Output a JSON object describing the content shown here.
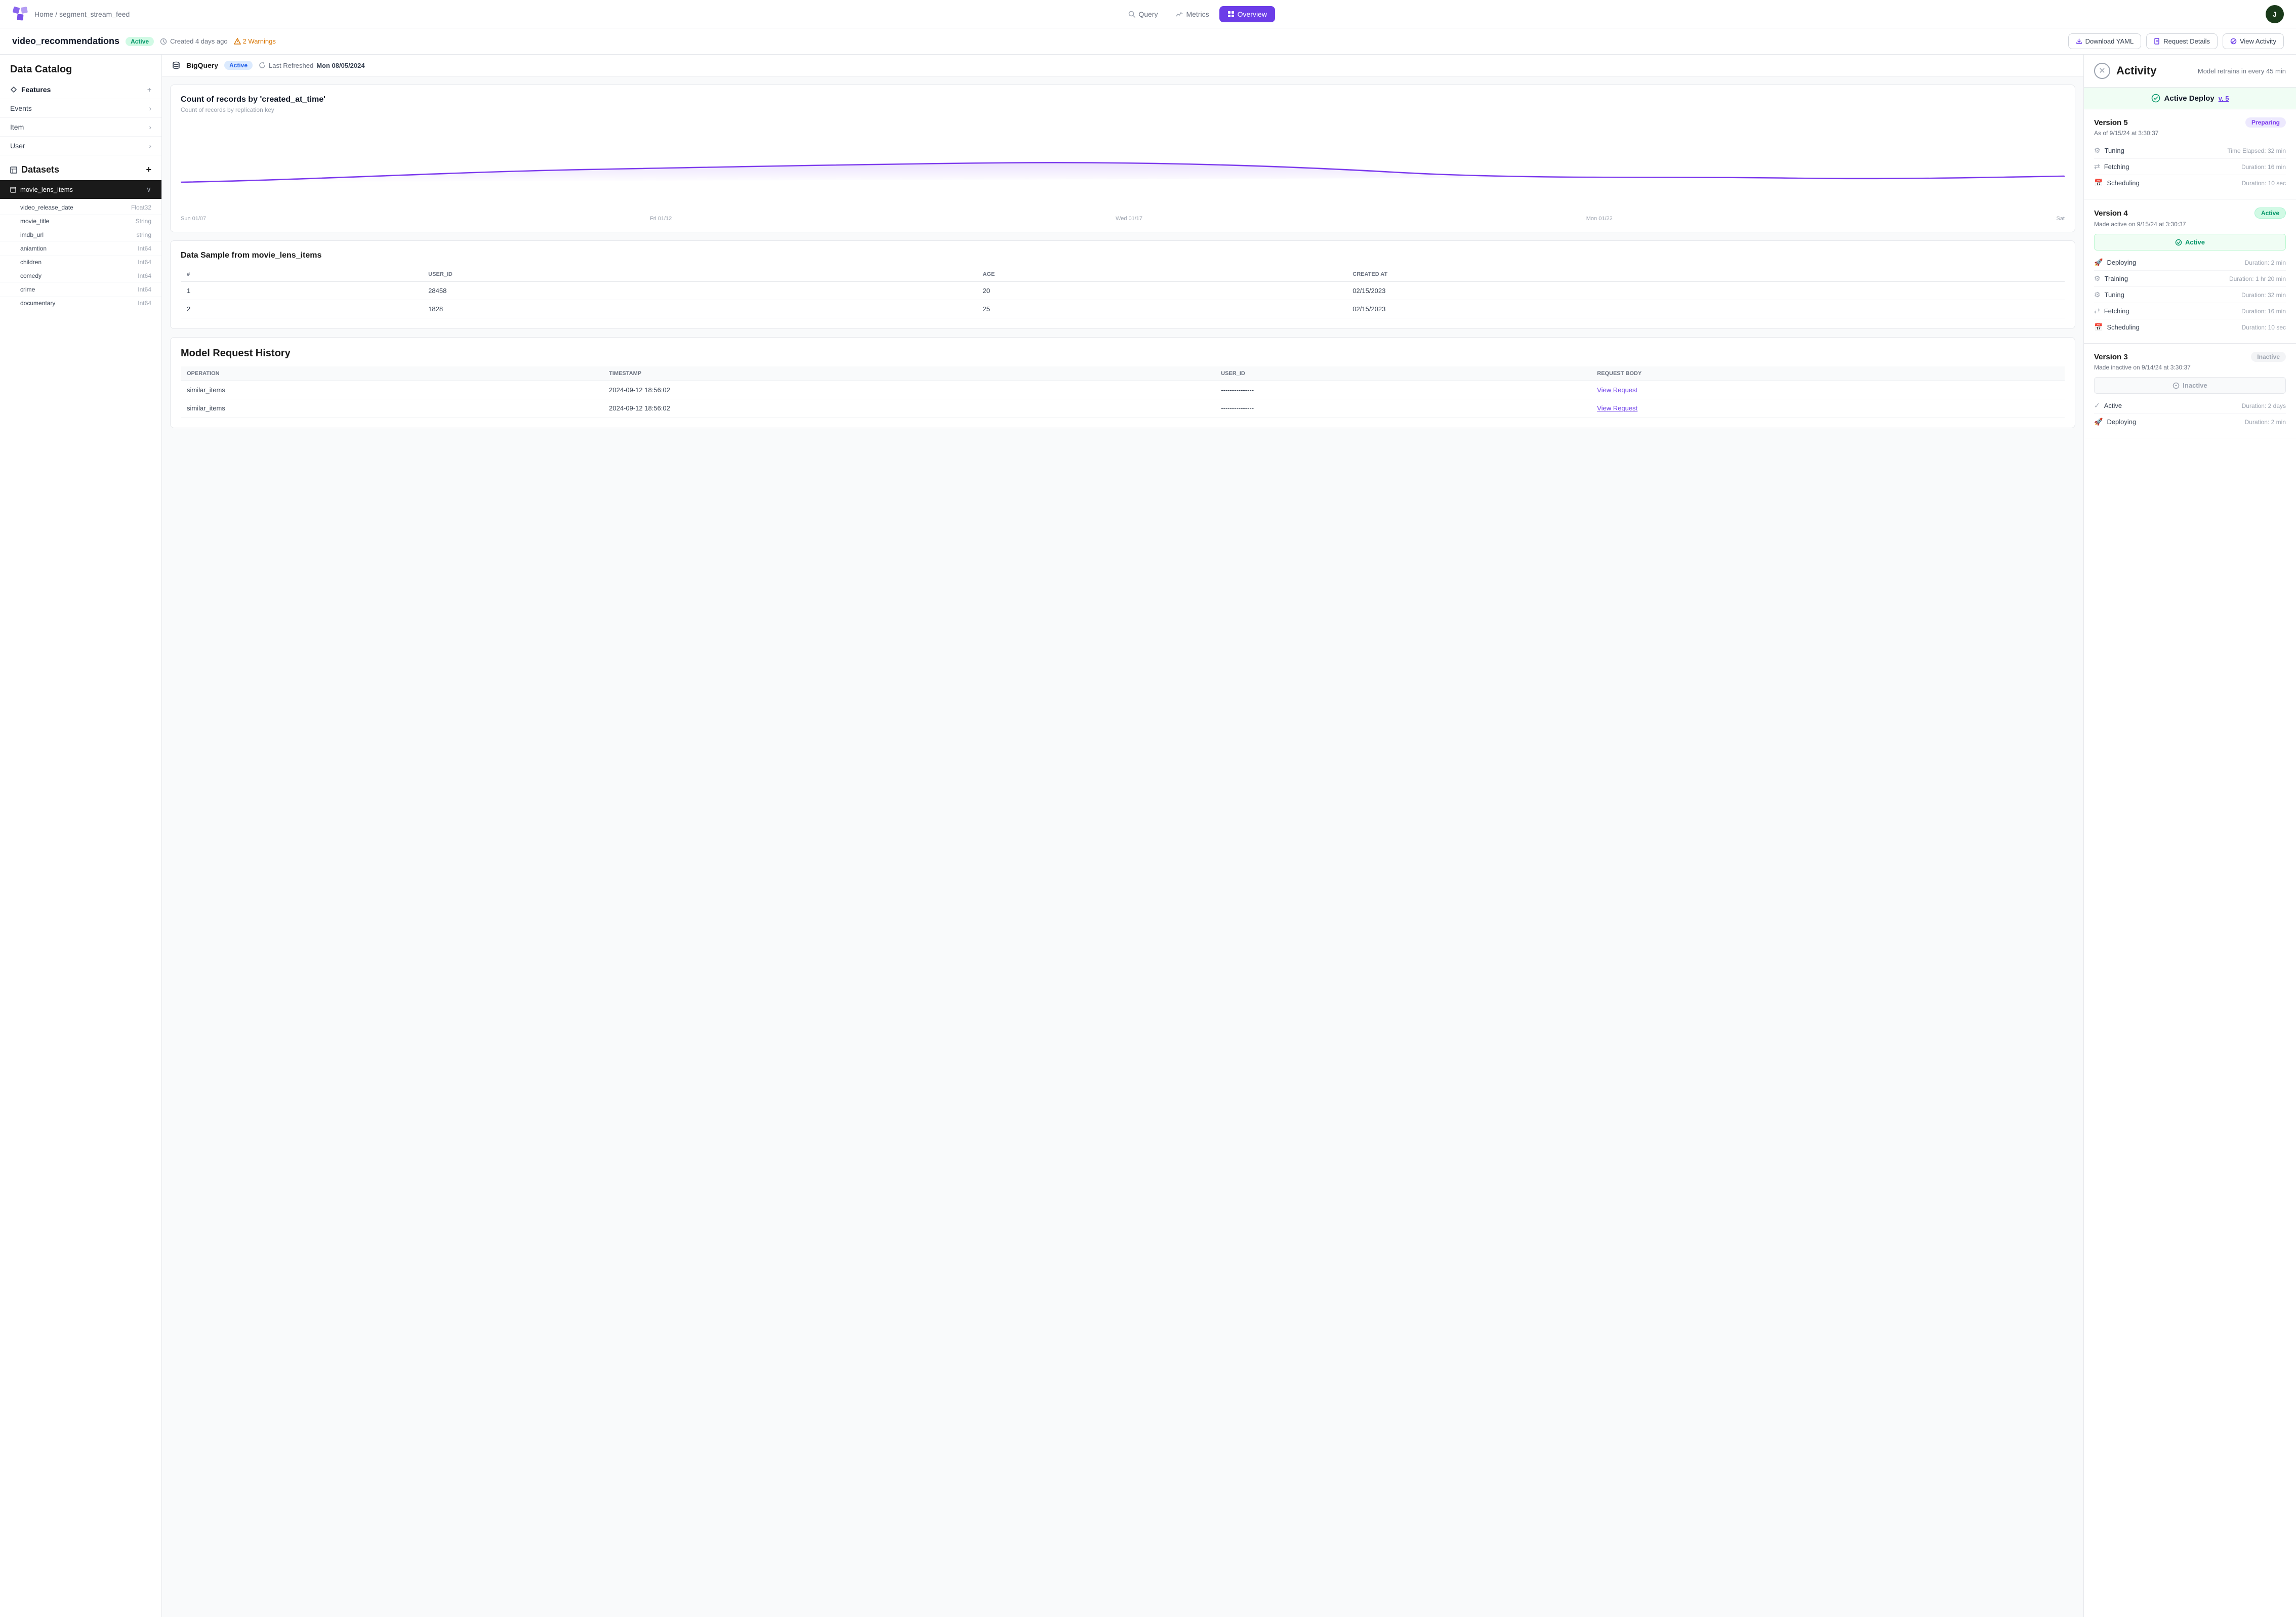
{
  "nav": {
    "breadcrumb": "Home / segment_stream_feed",
    "tabs": [
      {
        "id": "query",
        "label": "Query",
        "active": false
      },
      {
        "id": "metrics",
        "label": "Metrics",
        "active": false
      },
      {
        "id": "overview",
        "label": "Overview",
        "active": true
      }
    ],
    "avatar_initial": "J"
  },
  "subheader": {
    "model_name": "video_recommendations",
    "status": "Active",
    "created": "Created 4 days ago",
    "warnings": "2 Warnings",
    "buttons": {
      "download": "Download YAML",
      "request": "Request Details",
      "activity": "View Activity"
    }
  },
  "left_panel": {
    "catalog_title": "Data Catalog",
    "features_label": "Features",
    "feature_items": [
      "Events",
      "Item",
      "User"
    ],
    "datasets_label": "Datasets",
    "active_dataset": "movie_lens_items",
    "dataset_columns": [
      {
        "name": "video_release_date",
        "type": "Float32"
      },
      {
        "name": "movie_title",
        "type": "String"
      },
      {
        "name": "imdb_url",
        "type": "string"
      },
      {
        "name": "aniamtion",
        "type": "Int64"
      },
      {
        "name": "children",
        "type": "Int64"
      },
      {
        "name": "comedy",
        "type": "Int64"
      },
      {
        "name": "crime",
        "type": "Int64"
      },
      {
        "name": "documentary",
        "type": "Int64"
      }
    ]
  },
  "center": {
    "datasource": "BigQuery",
    "datasource_status": "Active",
    "last_refreshed_label": "Last Refreshed",
    "last_refreshed_date": "Mon 08/05/2024",
    "chart_title": "Count of records by 'created_at_time'",
    "chart_subtitle": "Count of records by replication key",
    "x_axis_labels": [
      "Sun 01/07",
      "Fri 01/12",
      "Wed 01/17",
      "Mon 01/22",
      "Sat"
    ],
    "data_sample_title": "Data Sample from movie_lens_items",
    "table_headers": [
      "#",
      "USER_ID",
      "AGE",
      "CREATED AT"
    ],
    "table_rows": [
      {
        "num": "1",
        "user_id": "28458",
        "age": "20",
        "created_at": "02/15/2023"
      },
      {
        "num": "2",
        "user_id": "1828",
        "age": "25",
        "created_at": "02/15/2023"
      }
    ],
    "history_title": "Model Request History",
    "history_headers": [
      "OPERATION",
      "TIMESTAMP",
      "USER_ID",
      "REQUEST BODY"
    ],
    "history_rows": [
      {
        "operation": "similar_items",
        "timestamp": "2024-09-12 18:56:02",
        "user_id": "---------------",
        "request": "View Request"
      },
      {
        "operation": "similar_items",
        "timestamp": "2024-09-12 18:56:02",
        "user_id": "---------------",
        "request": "View Request"
      }
    ]
  },
  "activity": {
    "title": "Activity",
    "retrain_info": "Model retrains in every 45 min",
    "active_deploy_label": "Active Deploy",
    "active_deploy_version": "v. 5",
    "versions": [
      {
        "id": "v5",
        "name": "Version 5",
        "date": "As of 9/15/24 at 3:30:37",
        "badge": "Preparing",
        "badge_type": "preparing",
        "status_bar": null,
        "steps": [
          {
            "icon": "tuning",
            "label": "Tuning",
            "duration": "Time Elapsed: 32 min"
          },
          {
            "icon": "fetching",
            "label": "Fetching",
            "duration": "Duration: 16 min"
          },
          {
            "icon": "scheduling",
            "label": "Scheduling",
            "duration": "Duration: 10 sec"
          }
        ]
      },
      {
        "id": "v4",
        "name": "Version 4",
        "date": "Made active on 9/15/24 at 3:30:37",
        "badge": "Active",
        "badge_type": "active",
        "status_bar": "Active",
        "status_bar_type": "active",
        "steps": [
          {
            "icon": "deploying",
            "label": "Deploying",
            "duration": "Duration: 2 min"
          },
          {
            "icon": "training",
            "label": "Training",
            "duration": "Duration: 1 hr 20 min"
          },
          {
            "icon": "tuning",
            "label": "Tuning",
            "duration": "Duration: 32 min"
          },
          {
            "icon": "fetching",
            "label": "Fetching",
            "duration": "Duration: 16 min"
          },
          {
            "icon": "scheduling",
            "label": "Scheduling",
            "duration": "Duration: 10 sec"
          }
        ]
      },
      {
        "id": "v3",
        "name": "Version 3",
        "date": "Made inactive on 9/14/24 at 3:30:37",
        "badge": "Inactive",
        "badge_type": "inactive",
        "status_bar": "Inactive",
        "status_bar_type": "inactive",
        "steps": [
          {
            "icon": "active",
            "label": "Active",
            "duration": "Duration: 2 days"
          },
          {
            "icon": "deploying",
            "label": "Deploying",
            "duration": "Duration: 2 min"
          }
        ]
      }
    ]
  }
}
